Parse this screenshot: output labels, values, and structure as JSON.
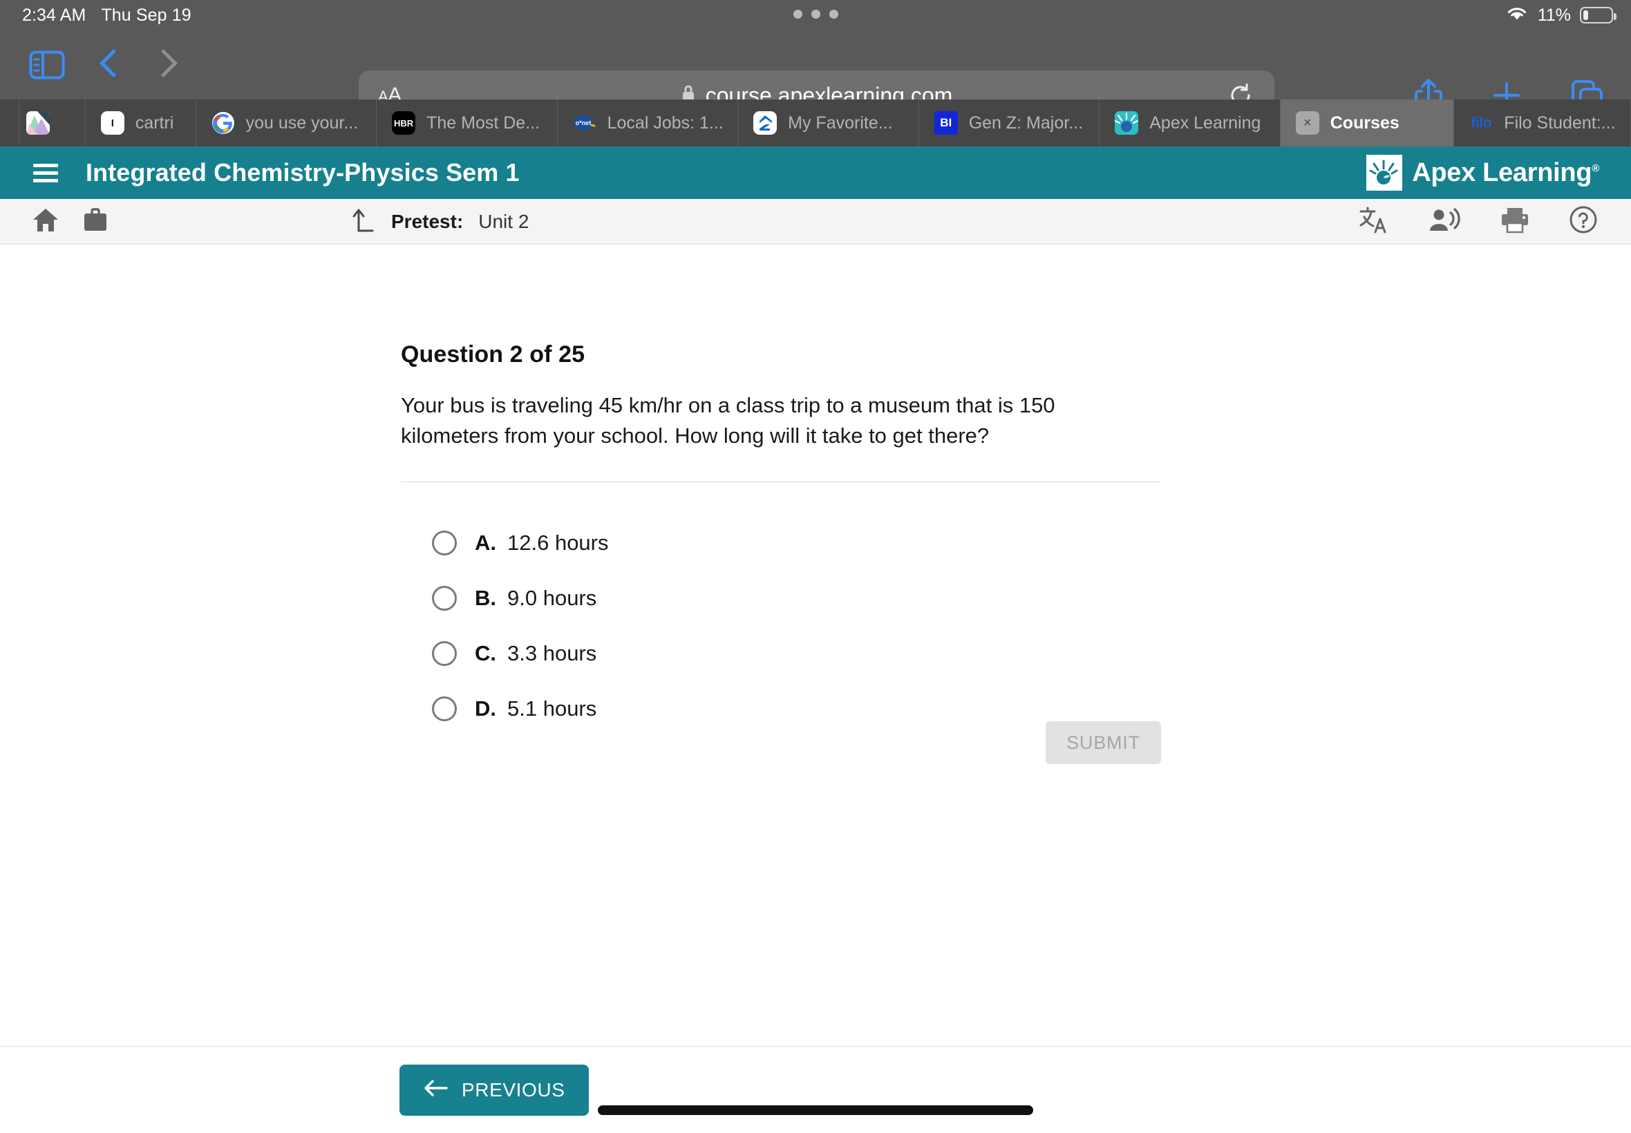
{
  "status_bar": {
    "time": "2:34 AM",
    "date": "Thu Sep 19",
    "battery_percent": "11%",
    "wifi_icon": "wifi-icon",
    "battery_icon": "battery-icon"
  },
  "browser": {
    "sidebar_icon": "sidebar-toggle-icon",
    "back_icon": "back-chevron-icon",
    "forward_icon": "forward-chevron-icon",
    "aa_label": "AA",
    "url": "course.apexlearning.com",
    "lock_icon": "lock-icon",
    "reload_icon": "reload-icon",
    "share_icon": "share-icon",
    "new_tab_icon": "plus-icon",
    "tabs_overview_icon": "tab-overview-icon",
    "tabs": [
      {
        "label": "",
        "favicon": "image-thumbnail",
        "active": false
      },
      {
        "label": "cartri",
        "favicon": "instructure-icon",
        "active": false
      },
      {
        "label": "you use your...",
        "favicon": "google-icon",
        "active": false
      },
      {
        "label": "The Most De...",
        "favicon": "hbr-icon",
        "active": false
      },
      {
        "label": "Local Jobs: 1...",
        "favicon": "onet-icon",
        "active": false
      },
      {
        "label": "My Favorite...",
        "favicon": "zillow-icon",
        "active": false
      },
      {
        "label": "Gen Z: Major...",
        "favicon": "business-insider-icon",
        "active": false
      },
      {
        "label": "Apex Learning",
        "favicon": "apex-icon",
        "active": false
      },
      {
        "label": "Courses",
        "favicon": "close-icon",
        "active": true
      },
      {
        "label": "Filo Student:...",
        "favicon": "filo-icon",
        "active": false
      }
    ]
  },
  "apex_header": {
    "menu_icon": "hamburger-menu-icon",
    "course_title": "Integrated Chemistry-Physics Sem 1",
    "logo_text": "Apex Learning",
    "logo_trademark": "®",
    "brand_color": "#16808f"
  },
  "toolbar": {
    "home_icon": "home-icon",
    "briefcase_icon": "briefcase-icon",
    "up_arrow_icon": "return-up-icon",
    "breadcrumb_label": "Pretest:",
    "breadcrumb_value": "Unit 2",
    "translate_icon": "translate-icon",
    "text_to_speech_icon": "text-to-speech-icon",
    "print_icon": "print-icon",
    "help_icon": "help-icon"
  },
  "question": {
    "title": "Question 2 of 25",
    "text": "Your bus is traveling 45 km/hr on a class trip to a museum that is 150 kilometers from your school. How long will it take to get there?",
    "choices": [
      {
        "letter": "A.",
        "text": "12.6 hours",
        "selected": false
      },
      {
        "letter": "B.",
        "text": "9.0 hours",
        "selected": false
      },
      {
        "letter": "C.",
        "text": "3.3 hours",
        "selected": false
      },
      {
        "letter": "D.",
        "text": "5.1 hours",
        "selected": false
      }
    ],
    "submit_label": "SUBMIT"
  },
  "footer": {
    "previous_label": "PREVIOUS",
    "previous_arrow_icon": "arrow-left-icon"
  }
}
